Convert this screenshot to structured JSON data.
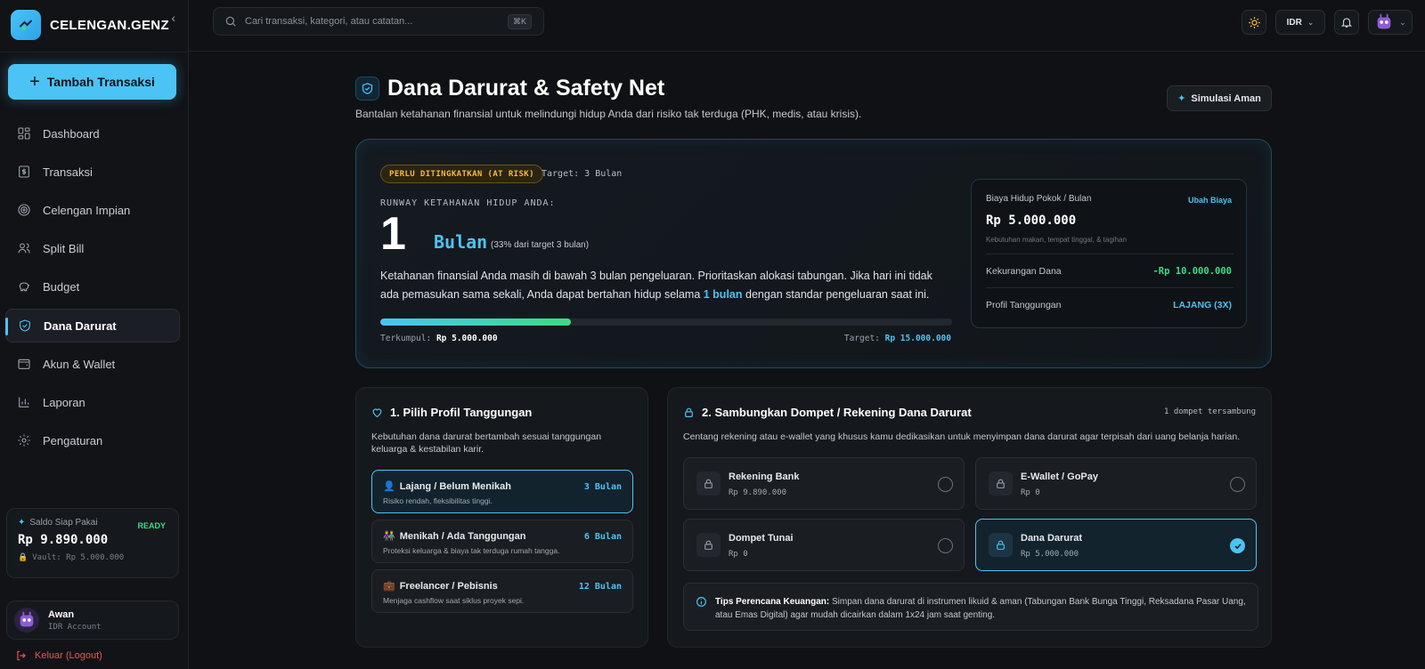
{
  "brand": {
    "name": "CELENGAN.GENZ"
  },
  "sidebar": {
    "add_label": "Tambah Transaksi",
    "items": [
      {
        "label": "Dashboard",
        "icon": "dashboard-icon"
      },
      {
        "label": "Transaksi",
        "icon": "receipt-icon"
      },
      {
        "label": "Celengan Impian",
        "icon": "target-icon"
      },
      {
        "label": "Split Bill",
        "icon": "users-icon"
      },
      {
        "label": "Budget",
        "icon": "piggy-bank-icon"
      },
      {
        "label": "Dana Darurat",
        "icon": "shield-icon",
        "active": true
      },
      {
        "label": "Akun & Wallet",
        "icon": "wallet-icon"
      },
      {
        "label": "Laporan",
        "icon": "bar-chart-icon"
      },
      {
        "label": "Pengaturan",
        "icon": "gear-icon"
      }
    ],
    "saldo": {
      "label": "Saldo Siap Pakai",
      "status": "READY",
      "amount": "Rp 9.890.000",
      "vault": "Vault: Rp 5.000.000"
    },
    "user": {
      "name": "Awan",
      "account": "IDR Account"
    },
    "logout": "Keluar (Logout)"
  },
  "topbar": {
    "search_placeholder": "Cari transaksi, kategori, atau catatan...",
    "search_shortcut": "⌘K",
    "currency": "IDR"
  },
  "header": {
    "title": "Dana Darurat & Safety Net",
    "subtitle": "Bantalan ketahanan finansial untuk melindungi hidup Anda dari risiko tak terduga (PHK, medis, atau krisis).",
    "simulate_label": "Simulasi Aman"
  },
  "hero": {
    "badge": "PERLU DITINGKATKAN (AT RISK)",
    "target_label": "Target: 3 Bulan",
    "runway_label": "RUNWAY KETAHANAN HIDUP ANDA:",
    "runway_value": "1",
    "runway_unit": "Bulan",
    "runway_pct": "(33% dari target 3 bulan)",
    "desc_before": "Ketahanan finansial Anda masih di bawah 3 bulan pengeluaran. Prioritaskan alokasi tabungan. Jika hari ini tidak ada pemasukan sama sekali, Anda dapat bertahan hidup selama ",
    "desc_highlight": "1 bulan",
    "desc_after": " dengan standar pengeluaran saat ini.",
    "progress_fraction": 0.333,
    "collected_label": "Terkumpul:",
    "collected_value": "Rp 5.000.000",
    "target_label_short": "Target:",
    "target_value": "Rp 15.000.000",
    "side": {
      "cost_label": "Biaya Hidup Pokok / Bulan",
      "change_label": "Ubah Biaya",
      "cost_value": "Rp 5.000.000",
      "cost_note": "Kebutuhan makan, tempat tinggal, & tagihan",
      "shortfall_label": "Kekurangan Dana",
      "shortfall_value": "-Rp 10.000.000",
      "profile_label": "Profil Tanggungan",
      "profile_value": "LAJANG (3X)"
    }
  },
  "profile_card": {
    "title": "1. Pilih Profil Tanggungan",
    "desc": "Kebutuhan dana darurat bertambah sesuai tanggungan keluarga & kestabilan karir.",
    "options": [
      {
        "emoji": "👤",
        "title": "Lajang / Belum Menikah",
        "sub": "Risiko rendah, fleksibilitas tinggi.",
        "months": "3 Bulan",
        "selected": true
      },
      {
        "emoji": "👫",
        "title": "Menikah / Ada Tanggungan",
        "sub": "Proteksi keluarga & biaya tak terduga rumah tangga.",
        "months": "6 Bulan"
      },
      {
        "emoji": "💼",
        "title": "Freelancer / Pebisnis",
        "sub": "Menjaga cashflow saat siklus proyek sepi.",
        "months": "12 Bulan"
      }
    ]
  },
  "wallet_card": {
    "title": "2. Sambungkan Dompet / Rekening Dana Darurat",
    "connected": "1 dompet tersambung",
    "desc": "Centang rekening atau e-wallet yang khusus kamu dedikasikan untuk menyimpan dana darurat agar terpisah dari uang belanja harian.",
    "wallets": [
      {
        "name": "Rekening Bank",
        "amount": "Rp 9.890.000"
      },
      {
        "name": "E-Wallet / GoPay",
        "amount": "Rp 0"
      },
      {
        "name": "Dompet Tunai",
        "amount": "Rp 0"
      },
      {
        "name": "Dana Darurat",
        "amount": "Rp 5.000.000",
        "selected": true
      }
    ],
    "tips_label": "Tips Perencana Keuangan:",
    "tips_text": " Simpan dana darurat di instrumen likuid & aman (Tabungan Bank Bunga Tinggi, Reksadana Pasar Uang, atau Emas Digital) agar mudah dicairkan dalam 1x24 jam saat genting."
  },
  "colors": {
    "accent": "#4cc3f5",
    "success": "#3ddc84",
    "warning": "#f5b93b",
    "danger": "#ef5350"
  }
}
